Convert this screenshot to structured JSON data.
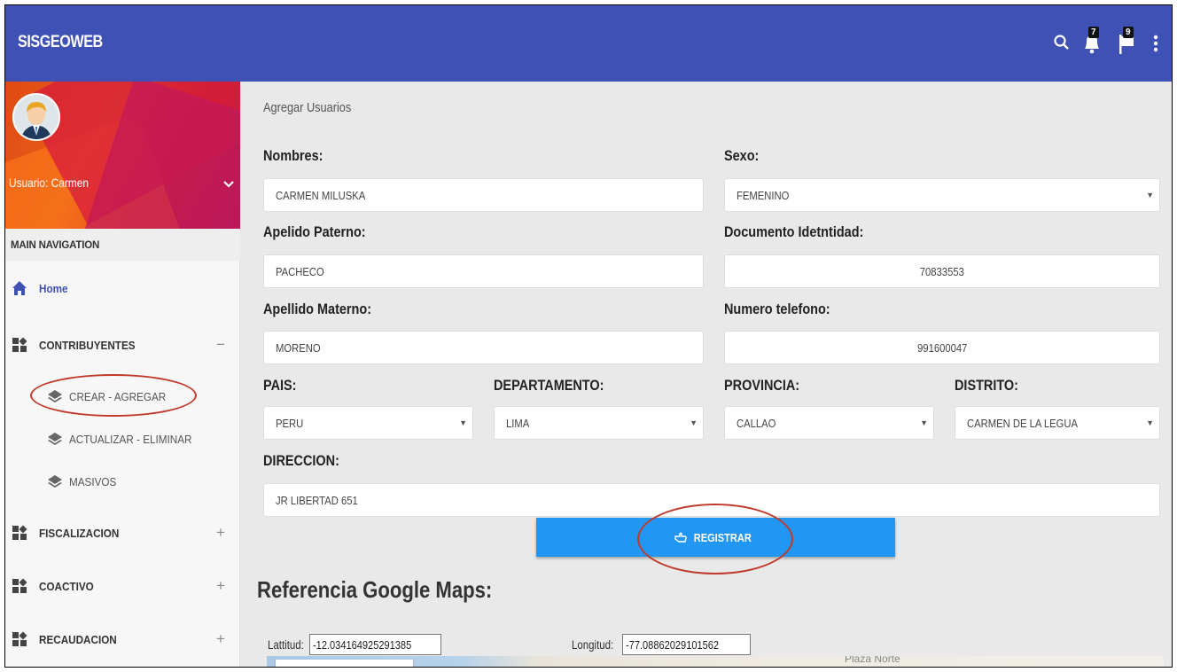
{
  "app": {
    "title": "SISGEOWEB"
  },
  "topbar": {
    "icons": [
      "search-icon",
      "bell-icon",
      "flag-icon",
      "more-vert-icon"
    ],
    "notifications_count": "7",
    "flags_count": "9"
  },
  "sidebar": {
    "user_label": "Usuario: Carmen",
    "nav_header": "MAIN NAVIGATION",
    "items": [
      {
        "label": "Home",
        "icon": "home-icon"
      },
      {
        "label": "CONTRIBUYENTES",
        "icon": "widgets-icon",
        "sign": "−"
      },
      {
        "label": "FISCALIZACION",
        "icon": "widgets-icon",
        "sign": "+"
      },
      {
        "label": "COACTIVO",
        "icon": "widgets-icon",
        "sign": "+"
      },
      {
        "label": "RECAUDACION",
        "icon": "widgets-icon",
        "sign": "+"
      }
    ],
    "subitems": [
      {
        "label": "CREAR - AGREGAR",
        "icon": "layers-icon"
      },
      {
        "label": "ACTUALIZAR - ELIMINAR",
        "icon": "layers-icon"
      },
      {
        "label": "MASIVOS",
        "icon": "layers-icon"
      }
    ]
  },
  "form": {
    "breadcrumb": "Agregar Usuarios",
    "nombres": {
      "label": "Nombres:",
      "value": "CARMEN MILUSKA"
    },
    "sexo": {
      "label": "Sexo:",
      "value": "FEMENINO"
    },
    "apellido_paterno": {
      "label": "Apelido Paterno:",
      "value": "PACHECO"
    },
    "documento": {
      "label": "Documento Idetntidad:",
      "value": "70833553"
    },
    "apellido_materno": {
      "label": "Apellido Materno:",
      "value": "MORENO"
    },
    "telefono": {
      "label": "Numero telefono:",
      "value": "991600047"
    },
    "pais": {
      "label": "PAIS:",
      "value": "PERU"
    },
    "departamento": {
      "label": "DEPARTAMENTO:",
      "value": "LIMA"
    },
    "provincia": {
      "label": "PROVINCIA:",
      "value": "CALLAO"
    },
    "distrito": {
      "label": "DISTRITO:",
      "value": "CARMEN DE LA LEGUA"
    },
    "direccion": {
      "label": "DIRECCION:",
      "value": "JR LIBERTAD 651"
    },
    "register_button": "REGISTRAR"
  },
  "maps": {
    "title": "Referencia Google Maps:",
    "lat_label": "Lattitud:",
    "lat_value": "-12.034164925291385",
    "lng_label": "Longitud:",
    "lng_value": "-77.08862029101562",
    "map_place_label": "Plaza Norte"
  },
  "colors": {
    "header": "#3f51b5",
    "button": "#2196f3",
    "annotation": "#c0392b"
  }
}
